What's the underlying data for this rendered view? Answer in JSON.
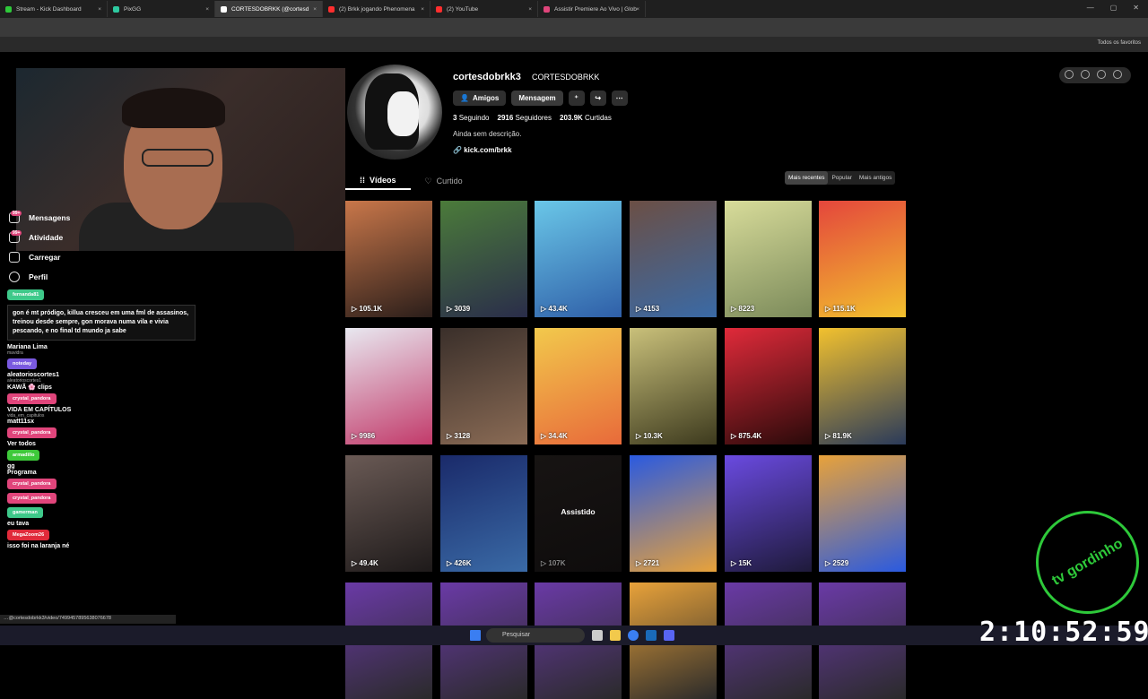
{
  "browser": {
    "tabs": [
      {
        "label": "Stream - Kick Dashboard",
        "color": "#2ec93a"
      },
      {
        "label": "PixGG",
        "color": "#2ec9a0"
      },
      {
        "label": "CORTESDOBRKK (@cortesd",
        "color": "#ffffff",
        "active": true
      },
      {
        "label": "(2) Brkk jogando Phenomena",
        "color": "#ff2e2e"
      },
      {
        "label": "(2) YouTube",
        "color": "#ff2e2e"
      },
      {
        "label": "Assistir Premiere Ao Vivo | Glob",
        "color": "#e0457b"
      }
    ],
    "bookmarks_all": "Todos os favoritos",
    "status_url": "…@cortesdobrkk3/video/7499457895638076678"
  },
  "sidenav": {
    "items": [
      {
        "label": "Mensagens",
        "badge": "99+"
      },
      {
        "label": "Atividade",
        "badge": "99+"
      },
      {
        "label": "Carregar"
      },
      {
        "label": "Perfil"
      }
    ]
  },
  "chat": {
    "users": [
      "fernanda81",
      "noteday",
      "crystal_pandora",
      "crystal_pandora",
      "armadillo",
      "crystal_pandora",
      "crystal_pandora",
      "gamerman",
      "MegaZoom26"
    ],
    "message_long": "gon é mt pródigo, killua cresceu em uma fml de assasinos, treinou desde sempre, gon morava numa vila e vivia pescando, e no final td mundo ja sabe",
    "follow": [
      {
        "name": "Mariana Lima",
        "sub": "mavidra"
      },
      {
        "name": "aleatorioscortes1",
        "sub": "aleatorioscortes1"
      },
      {
        "name": "KAWÃ 🌸 clips",
        "sub": ""
      },
      {
        "name": "VIDA EM CAPÍTULOS",
        "sub": "vida_em_capitulos"
      },
      {
        "name": "matt11sx",
        "sub": ""
      }
    ],
    "see_all": "Ver todos",
    "gg": "gg",
    "programa": "Programa",
    "eu_tava": "eu tava",
    "last": "isso foi na laranja né"
  },
  "profile": {
    "username": "cortesdobrkk3",
    "display_name": "CORTESDOBRKK",
    "buttons": {
      "friends": "Amigos",
      "message": "Mensagem"
    },
    "stats": [
      {
        "value": "3",
        "label": "Seguindo"
      },
      {
        "value": "2916",
        "label": "Seguidores"
      },
      {
        "value": "203.9K",
        "label": "Curtidas"
      }
    ],
    "description": "Ainda sem descrição.",
    "link": "kick.com/brkk",
    "tabs": [
      "Vídeos",
      "Curtido"
    ],
    "sort": [
      "Mais recentes",
      "Popular",
      "Mais antigos"
    ]
  },
  "videos": [
    {
      "views": "105.1K",
      "colors": [
        "#c9774a",
        "#2b1e1a"
      ]
    },
    {
      "views": "3039",
      "colors": [
        "#4b7b3a",
        "#2a2d4a"
      ]
    },
    {
      "views": "43.4K",
      "colors": [
        "#6ac7e8",
        "#2f5fa8"
      ]
    },
    {
      "views": "4153",
      "colors": [
        "#6b4f45",
        "#3a6aa6"
      ]
    },
    {
      "views": "8223",
      "colors": [
        "#d8dc9a",
        "#7b8a5a"
      ]
    },
    {
      "views": "115.1K",
      "colors": [
        "#e4463c",
        "#f2c12e"
      ]
    },
    {
      "views": "9986",
      "colors": [
        "#e8e8f0",
        "#c23a6a"
      ]
    },
    {
      "views": "3128",
      "colors": [
        "#3a2f2a",
        "#8a6b55"
      ]
    },
    {
      "views": "34.4K",
      "colors": [
        "#f2c94c",
        "#e86a3a"
      ]
    },
    {
      "views": "10.3K",
      "colors": [
        "#c9c07a",
        "#3d3a1e"
      ]
    },
    {
      "views": "875.4K",
      "colors": [
        "#e02a3a",
        "#2a0a0a"
      ]
    },
    {
      "views": "81.9K",
      "colors": [
        "#f2c12e",
        "#2a3a5a"
      ]
    },
    {
      "views": "49.4K",
      "colors": [
        "#6a5a55",
        "#1e1a1a"
      ]
    },
    {
      "views": "426K",
      "colors": [
        "#1a2a6a",
        "#3a6aa6"
      ]
    },
    {
      "views": "107K",
      "watched": "Assistido",
      "colors": [
        "#2a2422",
        "#1a1616"
      ]
    },
    {
      "views": "2721",
      "colors": [
        "#2a5ae0",
        "#e8a23a"
      ]
    },
    {
      "views": "15K",
      "colors": [
        "#6a4ae0",
        "#1e1a3a"
      ]
    },
    {
      "views": "2529",
      "colors": [
        "#e8a23a",
        "#2a5ae0"
      ]
    },
    {
      "views": "",
      "colors": [
        "#6a3aa6",
        "#2a2a2a"
      ]
    },
    {
      "views": "",
      "colors": [
        "#6a3aa6",
        "#2a2a2a"
      ]
    },
    {
      "views": "",
      "colors": [
        "#6a3aa6",
        "#2a2a2a"
      ]
    },
    {
      "views": "",
      "colors": [
        "#e8a23a",
        "#2a2a2a"
      ]
    },
    {
      "views": "",
      "colors": [
        "#6a3aa6",
        "#2a2a2a"
      ]
    },
    {
      "views": "",
      "colors": [
        "#6a3aa6",
        "#2a2a2a"
      ]
    }
  ],
  "overlay": {
    "logo_text": "tv gordinho",
    "clock": "2:10:52:59"
  },
  "taskbar": {
    "search": "Pesquisar"
  }
}
